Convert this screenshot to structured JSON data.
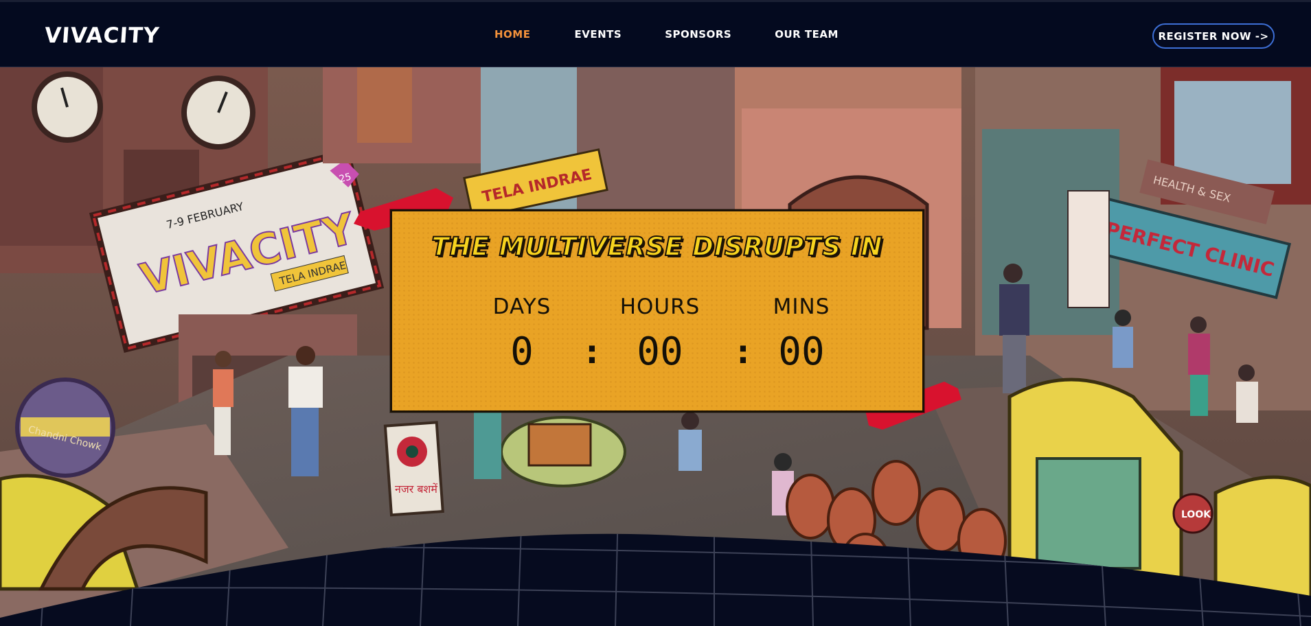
{
  "header": {
    "logo_text": "VIVACITY",
    "nav": [
      {
        "label": "HOME",
        "active": true
      },
      {
        "label": "EVENTS",
        "active": false
      },
      {
        "label": "SPONSORS",
        "active": false
      },
      {
        "label": "OUR TEAM",
        "active": false
      }
    ],
    "register_label": "REGISTER NOW ->"
  },
  "colors": {
    "background": "#030817",
    "nav_active": "#f4923b",
    "register_border": "#3d6fd6",
    "card_bg": "#e9a325",
    "title_yellow": "#f7d41e",
    "tape_red": "#d8122e"
  },
  "hero": {
    "illustration": "isometric-street-scene-illustration",
    "billboard": {
      "date": "7-9 FEBRUARY",
      "brand": "VIVACITY",
      "badge": "25",
      "tagline": "TELA INDRAE"
    },
    "shop_signs": [
      "TELA INDRAE",
      "PERFECT CLINIC",
      "HEALTH & SEX",
      "LOOK",
      "नजर बशमें",
      "Chandni Chowk"
    ]
  },
  "countdown": {
    "title": "THE MULTIVERSE DISRUPTS IN",
    "units": [
      {
        "label": "DAYS",
        "value": "0"
      },
      {
        "label": "HOURS",
        "value": "00"
      },
      {
        "label": "MINS",
        "value": "00"
      }
    ],
    "separator": ":"
  }
}
